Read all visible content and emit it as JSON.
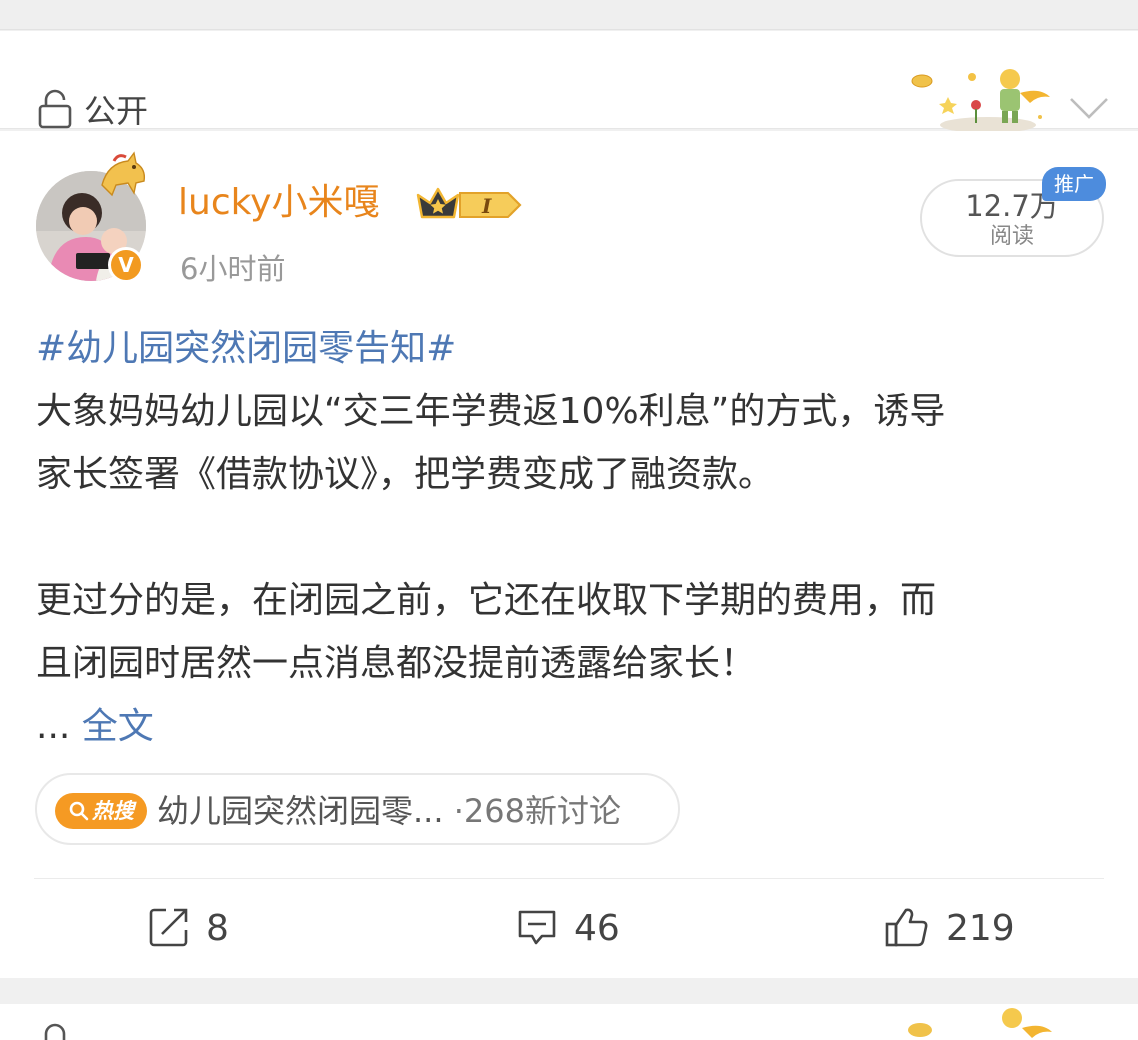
{
  "privacy": {
    "label": "公开"
  },
  "post": {
    "username": "lucky小米嘎",
    "level": "I",
    "verified_mark": "V",
    "time": "6小时前",
    "reads": {
      "count": "12.7万",
      "label": "阅读"
    },
    "promo_badge": "推广",
    "topic": "#幼儿园突然闭园零告知#",
    "lines": [
      "大象妈妈幼儿园以“交三年学费返10%利息”的方式，诱导",
      "家长签署《借款协议》，把学费变成了融资款。",
      "",
      "更过分的是，在闭园之前，它还在收取下学期的费用，而",
      "且闭园时居然一点消息都没提前透露给家长！"
    ],
    "ellipsis": "...",
    "full_text_link": "全文",
    "hot_search": {
      "badge": "热搜",
      "title": "幼儿园突然闭园零...",
      "separator": "·",
      "count": "268新讨论"
    },
    "actions": {
      "repost": "8",
      "comment": "46",
      "like": "219"
    }
  },
  "icons": [
    "lock-icon",
    "chevron-down-icon",
    "crown-icon",
    "search-icon",
    "repost-icon",
    "comment-icon",
    "like-icon"
  ],
  "colors": {
    "username": "#e8851c",
    "link": "#4e78b4",
    "promo": "#4d8cdd",
    "hot_badge": "#f59a23"
  }
}
